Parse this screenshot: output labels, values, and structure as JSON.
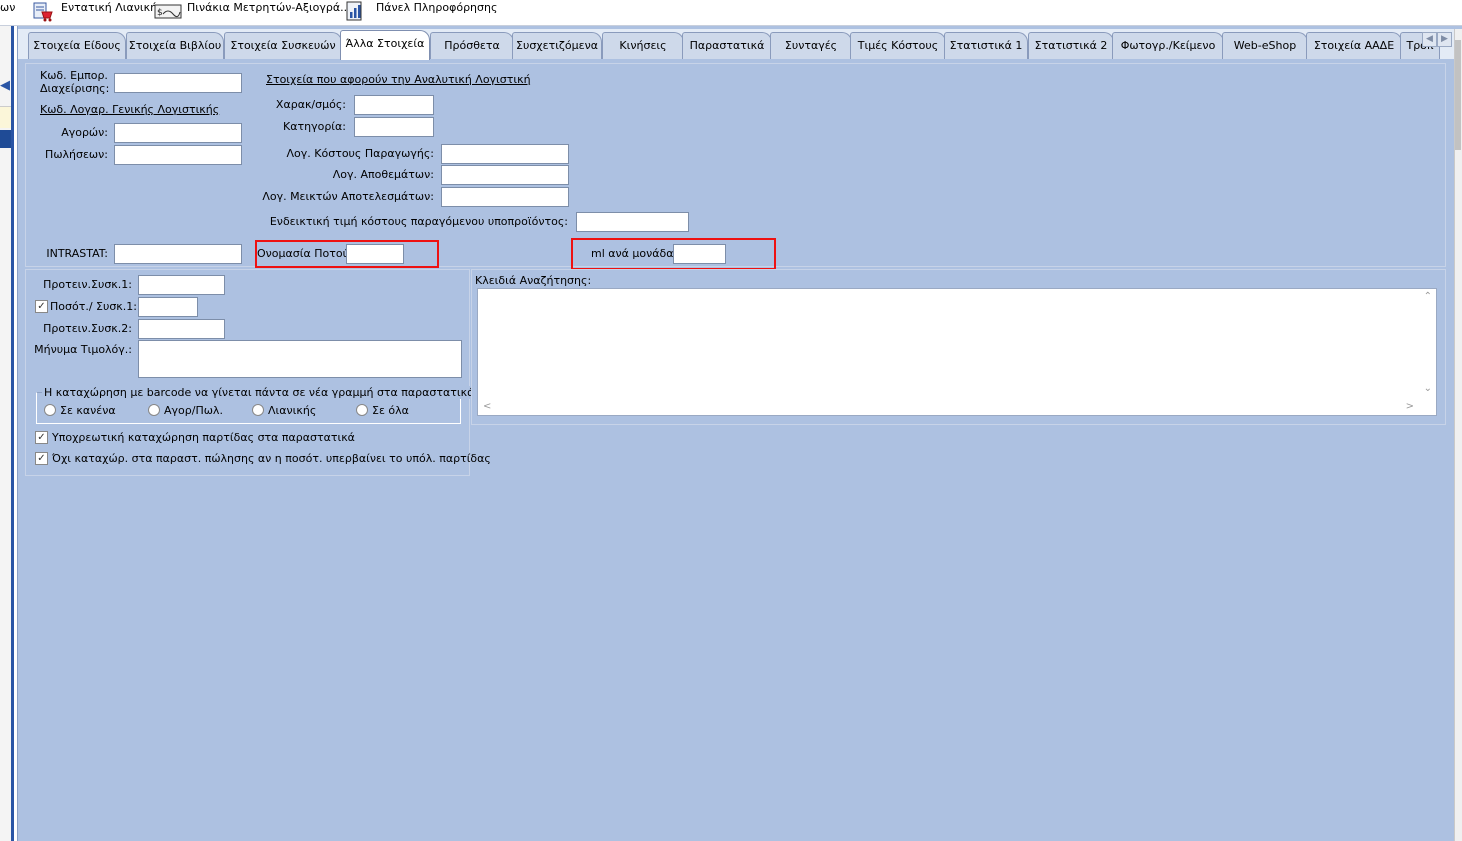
{
  "toolbar": {
    "cut_text": "ων",
    "items": [
      {
        "label": "Εντατική Λιανική",
        "icon": "retail-cart-icon"
      },
      {
        "label": "Πινάκια Μετρητών-Αξιογρά...",
        "icon": "cheque-icon"
      },
      {
        "label": "Πάνελ Πληροφόρησης",
        "icon": "info-panel-icon"
      }
    ]
  },
  "tabs": [
    {
      "label": "Στοιχεία Είδους",
      "active": false
    },
    {
      "label": "Στοιχεία Βιβλίου",
      "active": false
    },
    {
      "label": "Στοιχεία Συσκευών",
      "active": false
    },
    {
      "label": "Άλλα Στοιχεία",
      "active": true
    },
    {
      "label": "Πρόσθετα",
      "active": false
    },
    {
      "label": "Συσχετιζόμενα",
      "active": false
    },
    {
      "label": "Κινήσεις",
      "active": false
    },
    {
      "label": "Παραστατικά",
      "active": false
    },
    {
      "label": "Συνταγές",
      "active": false
    },
    {
      "label": "Τιμές Κόστους",
      "active": false
    },
    {
      "label": "Στατιστικά 1",
      "active": false
    },
    {
      "label": "Στατιστικά 2",
      "active": false
    },
    {
      "label": "Φωτογρ./Κείμενο",
      "active": false
    },
    {
      "label": "Web-eShop",
      "active": false
    },
    {
      "label": "Στοιχεία ΑΑΔΕ",
      "active": false
    },
    {
      "label": "Τρόπ",
      "active": false
    }
  ],
  "top_panel": {
    "kod_empor_label_1": "Κωδ. Εμπορ.",
    "kod_empor_label_2": "Διαχείρισης:",
    "kod_empor_value": "",
    "general_ledger_link": "Κωδ. Λογαρ. Γενικής Λογιστικής",
    "purchases_label": "Αγορών:",
    "purchases_value": "",
    "sales_label": "Πωλήσεων:",
    "sales_value": "",
    "analytic_link": "Στοιχεία που αφορούν την Αναλυτική Λογιστική",
    "character_label": "Χαρακ/σμός:",
    "character_value": "",
    "category_label": "Κατηγορία:",
    "category_value": "",
    "prod_cost_label": "Λογ. Κόστους Παραγωγής:",
    "prod_cost_value": "",
    "inventory_label": "Λογ. Αποθεμάτων:",
    "inventory_value": "",
    "mixed_results_label": "Λογ. Μεικτών Αποτελεσμάτων:",
    "mixed_results_value": "",
    "indicative_cost_label": "Ενδεικτική τιμή κόστους παραγόμενου υποπροϊόντος:",
    "indicative_cost_value": "",
    "intrastat_label": "INTRASTAT:",
    "intrastat_value": "",
    "drink_name_label": "Ονομασία Ποτού:",
    "drink_name_value": "",
    "ml_per_unit_label": "ml ανά μονάδα:",
    "ml_per_unit_value": ""
  },
  "left_panel": {
    "pkg1_label": "Προτειν.Συσκ.1:",
    "pkg1_value": "",
    "qty_pkg1_label": "Ποσότ./ Συσκ.1:",
    "qty_pkg1_checked": true,
    "qty_pkg1_value": "",
    "pkg2_label": "Προτειν.Συσκ.2:",
    "pkg2_value": "",
    "invoice_msg_label": "Μήνυμα Τιμολόγ.:",
    "invoice_msg_value": "",
    "barcode_group_title": "Η καταχώρηση με barcode να γίνεται πάντα σε νέα γραμμή στα παραστατικά",
    "barcode_options": [
      "Σε κανένα",
      "Αγορ/Πωλ.",
      "Λιανικής",
      "Σε όλα"
    ],
    "mandatory_lot_label": "Υποχρεωτική καταχώρηση παρτίδας στα παραστατικά",
    "mandatory_lot_checked": true,
    "no_entry_label": "Όχι καταχώρ. στα παραστ. πώλησης αν η ποσότ. υπερβαίνει το υπόλ. παρτίδας",
    "no_entry_checked": true
  },
  "right_panel": {
    "search_keys_label": "Κλειδιά Αναζήτησης:",
    "search_keys_value": ""
  },
  "colors": {
    "window_bg": "#adc1e1",
    "highlight_box": "#ee1111",
    "tab_bg": "#ced9ea"
  }
}
